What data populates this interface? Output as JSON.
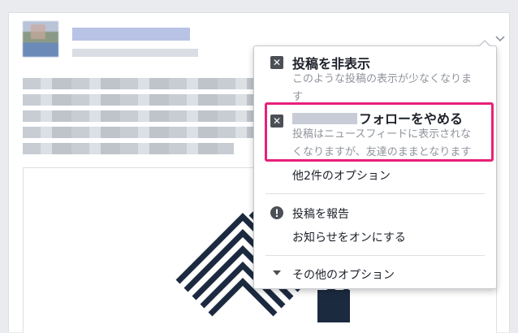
{
  "menu": {
    "hide_post": {
      "title": "投稿を非表示",
      "desc": "このような投稿の表示が少なくなりま\nす"
    },
    "unfollow": {
      "title": "フォローをやめる",
      "desc_line1": "投稿はニュースフィードに表示されな",
      "desc_line2": "くなりますが、友達のままとなります"
    },
    "more_options": "他2件のオプション",
    "report_post": "投稿を報告",
    "turn_on_notifications": "お知らせをオンにする",
    "other_options": "その他のオプション"
  },
  "colors": {
    "highlight": "#e8207a",
    "background": "#e9ebee",
    "menu_icon": "#4b4f56"
  },
  "icons": [
    "close-box-icon",
    "exclamation-icon",
    "caret-down-icon",
    "chevron-down-icon"
  ]
}
